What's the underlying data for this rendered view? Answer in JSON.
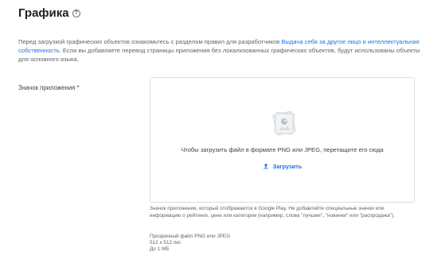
{
  "section": {
    "title": "Графика",
    "help_icon": "help-circle-icon",
    "help_glyph": "?"
  },
  "intro": {
    "text_before": "Перед загрузкой графических объектов ознакомьтесь с разделом правил для разработчиков ",
    "link_text": "Выдача себя за другое лицо и интеллектуальная собственность",
    "text_after": ". Если вы добавляете перевод страницы приложения без локализованных графических объектов, будут использованы объекты для основного языка."
  },
  "app_icon": {
    "label": "Значок приложения *",
    "upload_hint": "Чтобы загрузить файл в формате PNG или JPEG, перетащите его сюда",
    "upload_button": "Загрузить",
    "upload_icon": "upload-icon",
    "description": "Значок приложения, который отображается в Google Play. Не добавляйте специальные значки или информацию о рейтинге, цене или категории (например, слова \"лучшее\", \"новинки\" или \"распродажа\").",
    "spec_format": "Прозрачный файл PNG или JPEG",
    "spec_size": "512 x 512 пкс",
    "spec_max": "До 1 МБ"
  },
  "colors": {
    "link": "#1a73e8",
    "text_primary": "#202124",
    "text_secondary": "#5f6368",
    "border": "#dadce0"
  }
}
